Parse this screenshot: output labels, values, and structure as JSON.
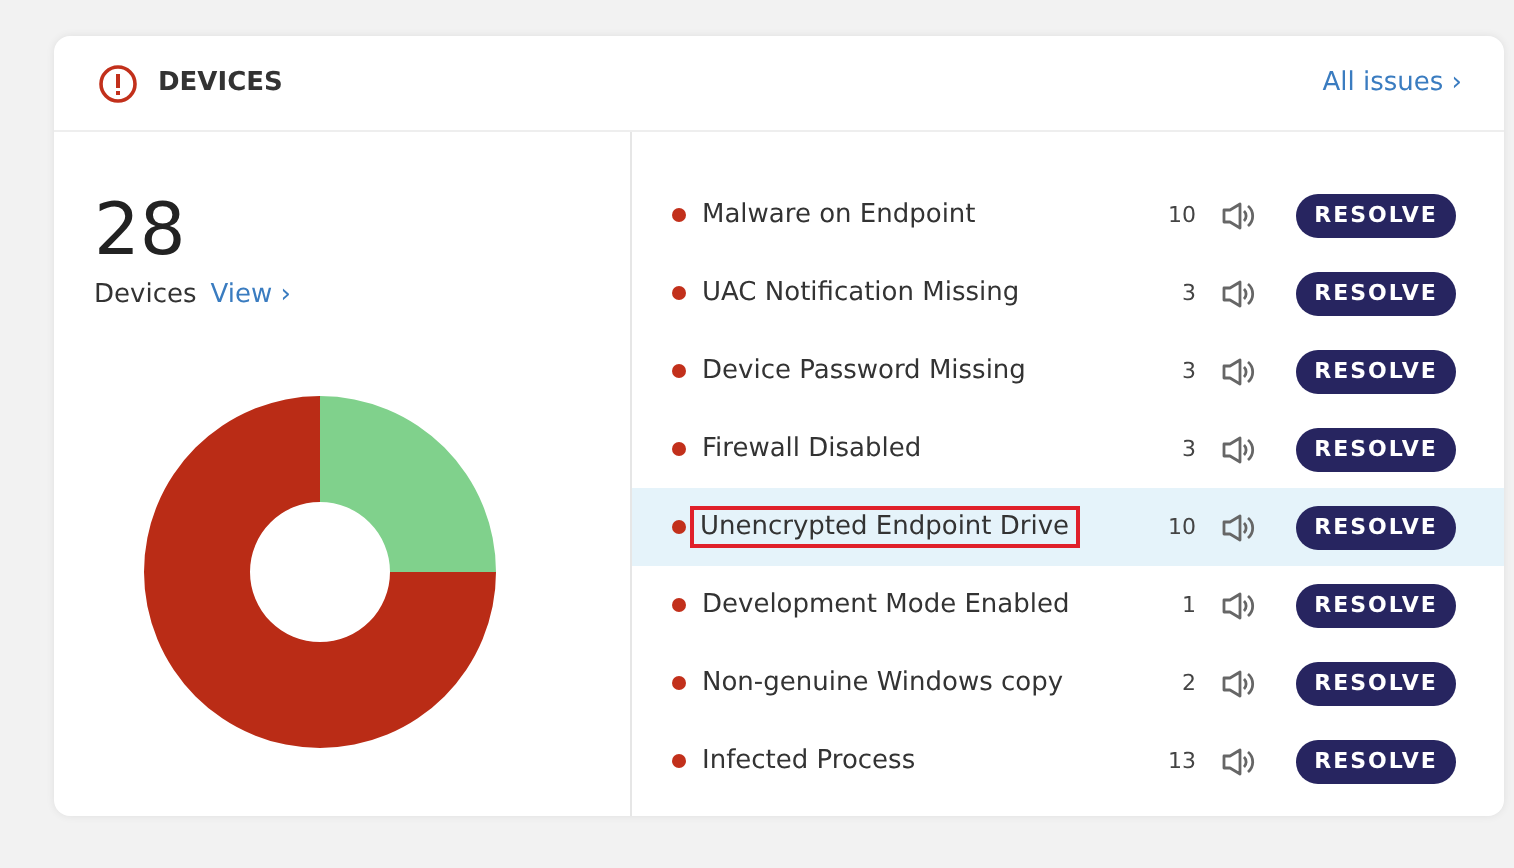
{
  "card": {
    "title": "DEVICES",
    "link": "All issues ›"
  },
  "summary": {
    "count": "28",
    "label": "Devices",
    "link": "View ›"
  },
  "issues": [
    {
      "name": "Malware on Endpoint",
      "count": "10",
      "selected": false,
      "outlined": false,
      "action": "RESOLVE"
    },
    {
      "name": "UAC Notification Missing",
      "count": "3",
      "selected": false,
      "outlined": false,
      "action": "RESOLVE"
    },
    {
      "name": "Device Password Missing",
      "count": "3",
      "selected": false,
      "outlined": false,
      "action": "RESOLVE"
    },
    {
      "name": "Firewall Disabled",
      "count": "3",
      "selected": false,
      "outlined": false,
      "action": "RESOLVE"
    },
    {
      "name": "Unencrypted Endpoint Drive",
      "count": "10",
      "selected": true,
      "outlined": true,
      "action": "RESOLVE"
    },
    {
      "name": "Development Mode Enabled",
      "count": "1",
      "selected": false,
      "outlined": false,
      "action": "RESOLVE"
    },
    {
      "name": "Non-genuine Windows copy",
      "count": "2",
      "selected": false,
      "outlined": false,
      "action": "RESOLVE"
    },
    {
      "name": "Infected Process",
      "count": "13",
      "selected": false,
      "outlined": false,
      "action": "RESOLVE"
    }
  ]
}
